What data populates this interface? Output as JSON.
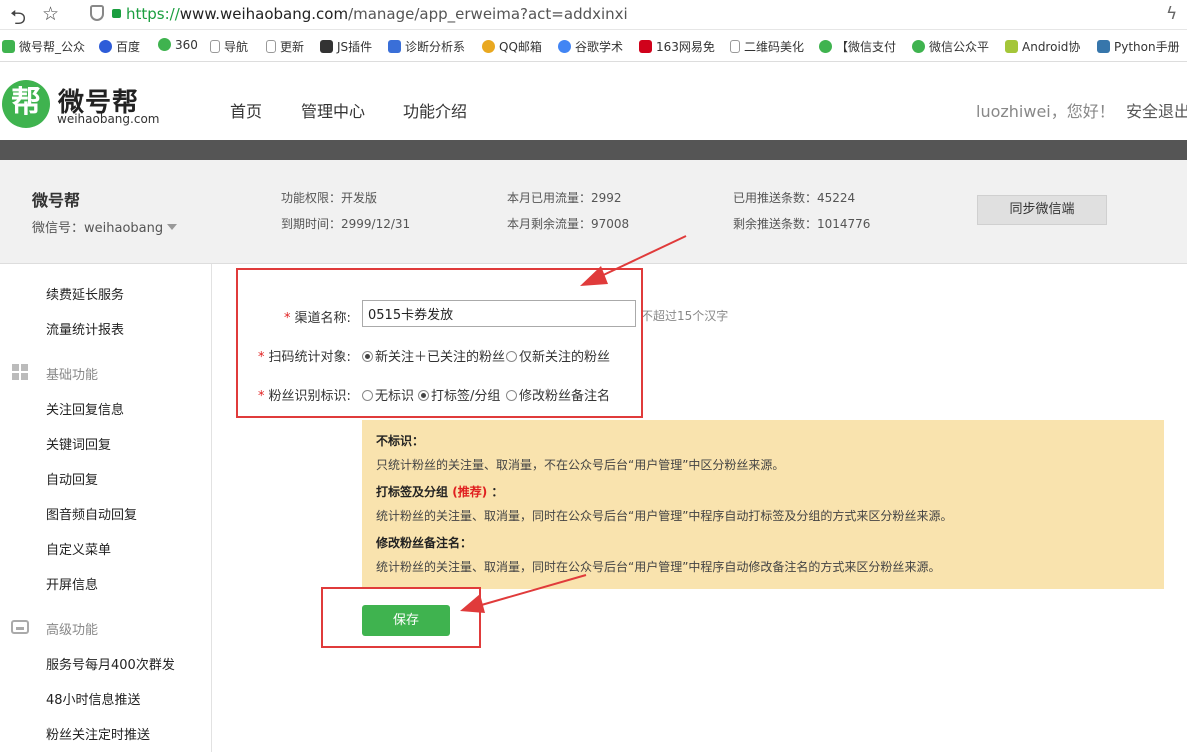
{
  "browser": {
    "url_scheme": "https://",
    "url_host": "www.weihaobang.com",
    "url_path": "/manage/app_erweima?act=addxinxi",
    "bookmarks": [
      {
        "label": "微号帮_公众",
        "color": "#3fb34f"
      },
      {
        "label": "百度",
        "color": "#2e5cd8"
      },
      {
        "label": "360",
        "color": "#3fb34f"
      },
      {
        "label": "导航",
        "color": "#cccccc"
      },
      {
        "label": "更新",
        "color": "#cccccc"
      },
      {
        "label": "JS插件",
        "color": "#333333"
      },
      {
        "label": "诊断分析系",
        "color": "#3a6fd8"
      },
      {
        "label": "QQ邮箱",
        "color": "#e9a820"
      },
      {
        "label": "谷歌学术",
        "color": "#4285f4"
      },
      {
        "label": "163网易免",
        "color": "#d0021b"
      },
      {
        "label": "二维码美化",
        "color": "#cccccc"
      },
      {
        "label": "【微信支付",
        "color": "#3fb34f"
      },
      {
        "label": "微信公众平",
        "color": "#3fb34f"
      },
      {
        "label": "Android协",
        "color": "#a4c639"
      },
      {
        "label": "Python手册",
        "color": "#3776ab"
      }
    ]
  },
  "header": {
    "logo_char": "帮",
    "logo_name": "微号帮",
    "logo_domain": "weihaobang.com",
    "nav": [
      "首页",
      "管理中心",
      "功能介绍"
    ],
    "greeting": "luozhiwei，您好！",
    "logout": "安全退出"
  },
  "account": {
    "name": "微号帮",
    "wechat_id": "微信号：weihaobang",
    "stats": {
      "permission": "功能权限：开发版",
      "expire": "到期时间：2999/12/31",
      "used_flow": "本月已用流量：2992",
      "remaining_flow": "本月剩余流量：97008",
      "pushed": "已用推送条数：45224",
      "remaining_push": "剩余推送条数：1014776"
    },
    "sync_button": "同步微信端"
  },
  "sidebar": {
    "items_top": [
      "续费延长服务",
      "流量统计报表"
    ],
    "group_basic": "基础功能",
    "items_basic": [
      "关注回复信息",
      "关键词回复",
      "自动回复",
      "图音频自动回复",
      "自定义菜单",
      "开屏信息"
    ],
    "group_advanced": "高级功能",
    "items_advanced": [
      "服务号每月400次群发",
      "48小时信息推送",
      "粉丝关注定时推送"
    ]
  },
  "form": {
    "channel_label": "渠道名称:",
    "channel_value": "0515卡券发放",
    "channel_hint": "不超过15个汉字",
    "scan_label": "扫码统计对象:",
    "scan_options": [
      "新关注＋已关注的粉丝",
      "仅新关注的粉丝"
    ],
    "scan_selected": 0,
    "fan_label": "粉丝识别标识:",
    "fan_options": [
      "无标识",
      "打标签/分组",
      "修改粉丝备注名"
    ],
    "fan_selected": 1,
    "info": {
      "t1": "不标识：",
      "d1": "只统计粉丝的关注量、取消量，不在公众号后台“用户管理”中区分粉丝来源。",
      "t2": "打标签及分组",
      "t2_rec": "(推荐)",
      "t2_colon": "：",
      "d2": "统计粉丝的关注量、取消量，同时在公众号后台“用户管理”中程序自动打标签及分组的方式来区分粉丝来源。",
      "t3": "修改粉丝备注名：",
      "d3": "统计粉丝的关注量、取消量，同时在公众号后台“用户管理”中程序自动修改备注名的方式来区分粉丝来源。"
    },
    "save_button": "保存"
  },
  "colors": {
    "brand_green": "#3fb34f",
    "annotation_red": "#e03b3b",
    "info_bg": "#f9e3ae"
  }
}
